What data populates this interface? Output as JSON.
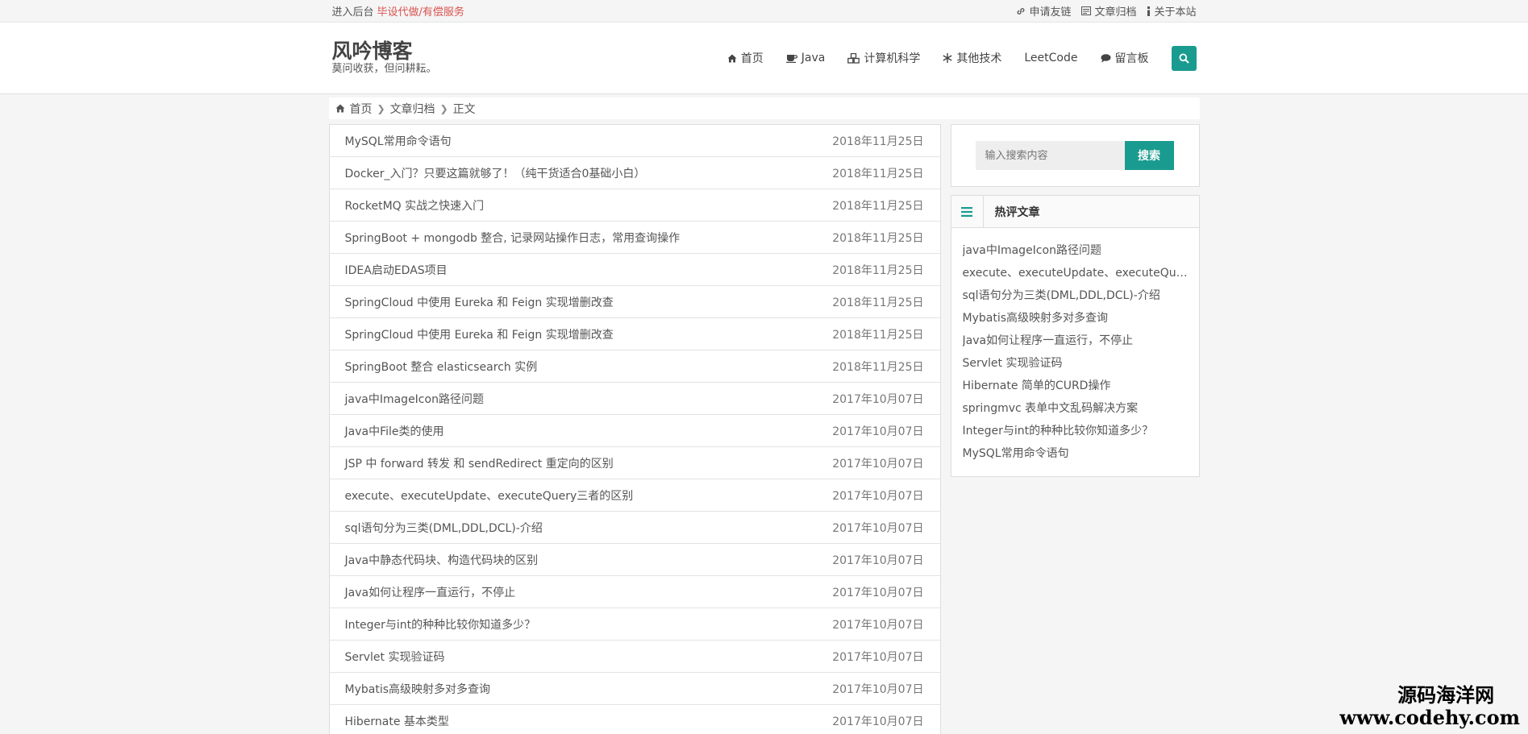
{
  "topbar": {
    "admin_text": "进入后台",
    "promo_text": "毕设代做/有偿服务",
    "links": [
      {
        "icon": "link-icon",
        "label": "申请友链"
      },
      {
        "icon": "archive-icon",
        "label": "文章归档"
      },
      {
        "icon": "info-icon",
        "label": "关于本站"
      }
    ]
  },
  "header": {
    "site_title": "风吟博客",
    "slogan": "莫问收获，但问耕耘。",
    "nav": [
      {
        "icon": "home-icon",
        "label": "首页"
      },
      {
        "icon": "coffee-icon",
        "label": "Java"
      },
      {
        "icon": "cubes-icon",
        "label": "计算机科学"
      },
      {
        "icon": "snowflake-icon",
        "label": "其他技术"
      },
      {
        "icon": "",
        "label": "LeetCode"
      },
      {
        "icon": "comment-icon",
        "label": "留言板"
      }
    ]
  },
  "breadcrumb": [
    "首页",
    "文章归档",
    "正文"
  ],
  "articles": [
    {
      "title": "MySQL常用命令语句",
      "date": "2018年11月25日"
    },
    {
      "title": "Docker_入门？只要这篇就够了！（纯干货适合0基础小白）",
      "date": "2018年11月25日"
    },
    {
      "title": "RocketMQ 实战之快速入门",
      "date": "2018年11月25日"
    },
    {
      "title": "SpringBoot + mongodb 整合, 记录网站操作日志，常用查询操作",
      "date": "2018年11月25日"
    },
    {
      "title": "IDEA启动EDAS项目",
      "date": "2018年11月25日"
    },
    {
      "title": "SpringCloud 中使用 Eureka 和 Feign 实现增删改查",
      "date": "2018年11月25日"
    },
    {
      "title": "SpringCloud 中使用 Eureka 和 Feign 实现增删改查",
      "date": "2018年11月25日"
    },
    {
      "title": "SpringBoot 整合 elasticsearch 实例",
      "date": "2018年11月25日"
    },
    {
      "title": "java中ImageIcon路径问题",
      "date": "2017年10月07日"
    },
    {
      "title": "Java中File类的使用",
      "date": "2017年10月07日"
    },
    {
      "title": "JSP 中 forward 转发 和 sendRedirect 重定向的区别",
      "date": "2017年10月07日"
    },
    {
      "title": "execute、executeUpdate、executeQuery三者的区别",
      "date": "2017年10月07日"
    },
    {
      "title": "sql语句分为三类(DML,DDL,DCL)-介绍",
      "date": "2017年10月07日"
    },
    {
      "title": "Java中静态代码块、构造代码块的区别",
      "date": "2017年10月07日"
    },
    {
      "title": "Java如何让程序一直运行，不停止",
      "date": "2017年10月07日"
    },
    {
      "title": "Integer与int的种种比较你知道多少？",
      "date": "2017年10月07日"
    },
    {
      "title": "Servlet 实现验证码",
      "date": "2017年10月07日"
    },
    {
      "title": "Mybatis高级映射多对多查询",
      "date": "2017年10月07日"
    },
    {
      "title": "Hibernate 基本类型",
      "date": "2017年10月07日"
    }
  ],
  "sidebar": {
    "search_placeholder": "输入搜索内容",
    "search_button": "搜索",
    "hot_title": "热评文章",
    "hot_list": [
      "java中ImageIcon路径问题",
      "execute、executeUpdate、executeQuery三者的区别",
      "sql语句分为三类(DML,DDL,DCL)-介绍",
      "Mybatis高级映射多对多查询",
      "Java如何让程序一直运行，不停止",
      "Servlet 实现验证码",
      "Hibernate 简单的CURD操作",
      "springmvc 表单中文乱码解决方案",
      "Integer与int的种种比较你知道多少？",
      "MySQL常用命令语句"
    ]
  },
  "watermark": {
    "line1": "源码海洋网",
    "line2": "www.codehy.com"
  },
  "colors": {
    "accent": "#1a9b8f",
    "promo": "#d9534f"
  }
}
